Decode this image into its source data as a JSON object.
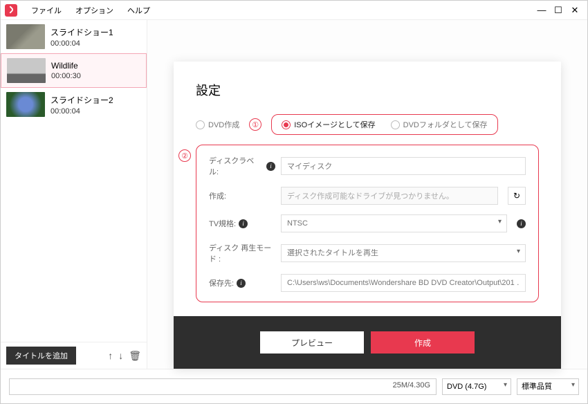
{
  "menu": {
    "file": "ファイル",
    "option": "オプション",
    "help": "ヘルプ"
  },
  "window": {
    "min": "—",
    "max": "☐",
    "close": "✕"
  },
  "items": [
    {
      "title": "スライドショー1",
      "dur": "00:00:04"
    },
    {
      "title": "Wildlife",
      "dur": "00:00:30"
    },
    {
      "title": "スライドショー2",
      "dur": "00:00:04"
    }
  ],
  "sidebar": {
    "add": "タイトルを追加",
    "up": "↑",
    "down": "↓",
    "del": "🗑"
  },
  "panel": {
    "title": "設定",
    "radios": {
      "dvd": "DVD作成",
      "iso": "ISOイメージとして保存",
      "folder": "DVDフォルダとして保存"
    },
    "callout1": "①",
    "callout2": "②",
    "labels": {
      "disc_label": "ディスクラベル:",
      "create": "作成:",
      "tv": "TV規格:",
      "playmode": "ディスク 再生モード :",
      "saveto": "保存先:"
    },
    "values": {
      "disc_label": "マイディスク",
      "create": "ディスク作成可能なドライブが見つかりません。",
      "tv": "NTSC",
      "playmode": "選択されたタイトルを再生",
      "saveto": "C:\\Users\\ws\\Documents\\Wondershare BD DVD Creator\\Output\\201 …"
    },
    "refresh": "↻",
    "footer": {
      "preview": "プレビュー",
      "create": "作成"
    }
  },
  "status": {
    "space": "25M/4.30G",
    "disc": "DVD (4.7G)",
    "quality": "標準品質"
  }
}
